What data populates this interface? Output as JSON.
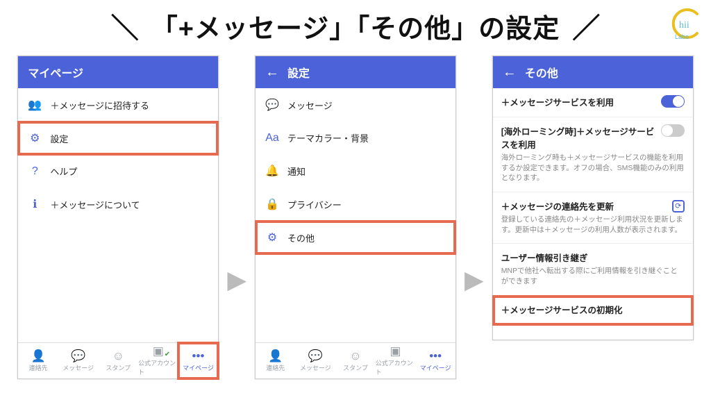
{
  "title": "「+メッセージ」「その他」の設定",
  "logo_label": "Chii Labo",
  "screen1": {
    "header": "マイページ",
    "items": [
      {
        "icon": "👥",
        "label": "＋メッセージに招待する"
      },
      {
        "icon": "⚙",
        "label": "設定"
      },
      {
        "icon": "?",
        "label": "ヘルプ"
      },
      {
        "icon": "ℹ",
        "label": "＋メッセージについて"
      }
    ],
    "nav": [
      "連絡先",
      "メッセージ",
      "スタンプ",
      "公式アカウント",
      "マイページ"
    ]
  },
  "screen2": {
    "header": "設定",
    "items": [
      {
        "icon": "💬",
        "label": "メッセージ"
      },
      {
        "icon": "Aa",
        "label": "テーマカラー・背景"
      },
      {
        "icon": "🔔",
        "label": "通知"
      },
      {
        "icon": "🔒",
        "label": "プライバシー"
      },
      {
        "icon": "⚙",
        "label": "その他"
      }
    ],
    "nav": [
      "連絡先",
      "メッセージ",
      "スタンプ",
      "公式アカウント",
      "マイページ"
    ]
  },
  "screen3": {
    "header": "その他",
    "s1": {
      "title": "＋メッセージサービスを利用"
    },
    "s2": {
      "title": "[海外ローミング時]＋メッセージサービスを利用",
      "desc": "海外ローミング時も＋メッセージサービスの機能を利用するか設定できます。オフの場合、SMS機能のみの利用となります。"
    },
    "s3": {
      "title": "＋メッセージの連絡先を更新",
      "desc": "登録している連絡先の＋メッセージ利用状況を更新します。更新中は＋メッセージの利用人数が表示されます。"
    },
    "s4": {
      "title": "ユーザー情報引き継ぎ",
      "desc": "MNPで他社へ転出する際にご利用情報を引き継ぐことができます"
    },
    "s5": {
      "title": "＋メッセージサービスの初期化"
    }
  }
}
